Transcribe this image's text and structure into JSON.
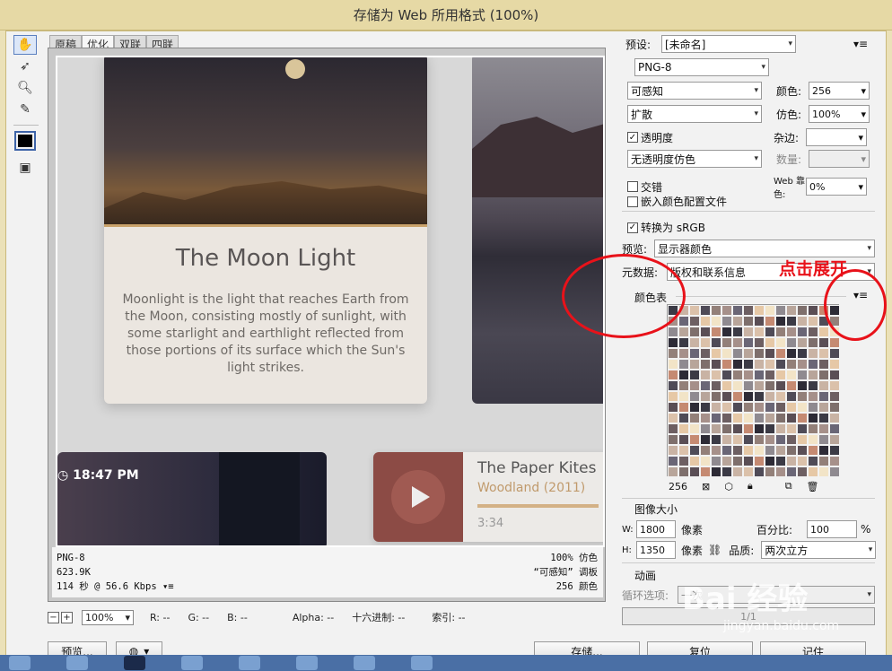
{
  "window": {
    "title": "存储为 Web 所用格式 (100%)"
  },
  "tabs": [
    "原稿",
    "优化",
    "双联",
    "四联"
  ],
  "active_tab": 1,
  "preview": {
    "card_title": "The Moon Light",
    "card_text": "Moonlight is the light that reaches Earth from the Moon, consisting mostly of sunlight, with some starlight and earthlight reflected from those portions of its surface which the Sun's light strikes.",
    "clock_time": "18:47 PM",
    "song_title": "The Paper Kites",
    "song_album": "Woodland (2011)",
    "song_duration": "3:34",
    "song_progress": 0.9
  },
  "preview_status": {
    "format": "PNG-8",
    "size": "623.9K",
    "time": "114 秒 @ 56.6 Kbps",
    "dither": "100% 仿色",
    "palette": "“可感知” 调板",
    "colors": "256 颜色"
  },
  "zoom": {
    "value": "100%",
    "r": "R: --",
    "g": "G: --",
    "b": "B: --",
    "alpha": "Alpha: --",
    "hex": "十六进制: --",
    "index": "索引: --"
  },
  "footer": {
    "preview_btn": "预览...",
    "save_btn": "存储...",
    "reset_btn": "复位",
    "remember_btn": "记住"
  },
  "settings": {
    "preset_label": "预设:",
    "preset_value": "[未命名]",
    "format_value": "PNG-8",
    "reduction_value": "可感知",
    "colors_label": "颜色:",
    "colors_value": "256",
    "dither_algo_value": "扩散",
    "dither_label": "仿色:",
    "dither_value": "100%",
    "transparency_label": "透明度",
    "matte_label": "杂边:",
    "transparency_dither_value": "无透明度仿色",
    "amount_label": "数量:",
    "interlaced_label": "交错",
    "web_snap_label": "Web 靠色:",
    "web_snap_value": "0%",
    "embed_profile_label": "嵌入颜色配置文件",
    "convert_srgb_label": "转换为 sRGB",
    "preview_label": "预览:",
    "preview_value": "显示器颜色",
    "metadata_label": "元数据:",
    "metadata_value": "版权和联系信息",
    "color_table_label": "颜色表",
    "color_count": "256",
    "image_size_label": "图像大小",
    "width_label": "W:",
    "width_value": "1800",
    "width_unit": "像素",
    "height_label": "H:",
    "height_value": "1350",
    "height_unit": "像素",
    "percent_label": "百分比:",
    "percent_value": "100",
    "percent_unit": "%",
    "quality_label": "品质:",
    "quality_value": "两次立方",
    "animation_label": "动画",
    "loop_label": "循环选项:",
    "loop_value": "一次",
    "frame_counter": "1/1"
  },
  "annotation": {
    "text": "点击展开",
    "color": "#e8121a"
  },
  "watermark": {
    "brand": "Bai 经验",
    "url": "jingyan.baidu.com"
  },
  "palette_colors": [
    "#3b3a45",
    "#6d5f62",
    "#c58a72",
    "#a6908a",
    "#7e6f6c",
    "#4f4b57",
    "#8f8a90",
    "#c9b3a4",
    "#e6c8a6",
    "#2d2b36",
    "#6a6676",
    "#5a4e55",
    "#938079",
    "#b8a59a",
    "#dbc1aa",
    "#f2e4c7"
  ]
}
